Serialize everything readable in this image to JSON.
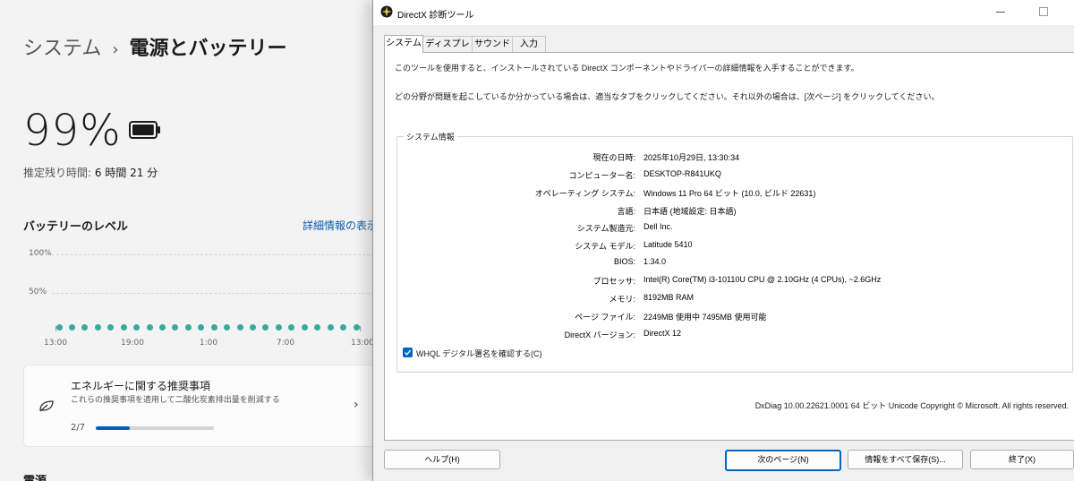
{
  "settings": {
    "breadcrumb_parent": "システム",
    "breadcrumb_sep": "›",
    "page_title": "電源とバッテリー",
    "battery_percent": "99%",
    "battery_level_fraction": 0.99,
    "remaining_label": "推定残り時間:",
    "remaining_value": "6 時間 21 分",
    "battery_level_heading": "バッテリーのレベル",
    "details_link": "詳細情報の表示",
    "chart_data": {
      "type": "scatter",
      "y_ticks": [
        "100%",
        "50%"
      ],
      "x_ticks": [
        "13:00",
        "19:00",
        "1:00",
        "7:00",
        "13:00"
      ],
      "ylim": [
        0,
        100
      ],
      "points_count": 24,
      "point_color": "#3aa99d"
    },
    "recommendation": {
      "title": "エネルギーに関する推奨事項",
      "subtitle": "これらの推奨事項を適用して二酸化炭素排出量を削減する",
      "progress_text": "2/7",
      "progress_fraction": 0.2857,
      "chevron": "›"
    },
    "power_heading": "電源"
  },
  "dxdiag": {
    "window_title": "DirectX 診断ツール",
    "tabs": [
      "システム",
      "ディスプレイ",
      "サウンド",
      "入力"
    ],
    "intro_line1": "このツールを使用すると、インストールされている DirectX コンポーネントやドライバーの詳細情報を入手することができます。",
    "intro_line2": "どの分野が問題を起こしているか分かっている場合は、適当なタブをクリックしてください。それ以外の場合は、[次ページ] をクリックしてください。",
    "group_title": "システム情報",
    "info": [
      {
        "key": "現在の日時:",
        "value": "2025年10月29日, 13:30:34"
      },
      {
        "key": "コンピューター名:",
        "value": "DESKTOP-R841UKQ"
      },
      {
        "key": "オペレーティング システム:",
        "value": "Windows 11 Pro 64 ビット (10.0, ビルド 22631)"
      },
      {
        "key": "言語:",
        "value": "日本語 (地域設定: 日本語)"
      },
      {
        "key": "システム製造元:",
        "value": "Dell Inc."
      },
      {
        "key": "システム モデル:",
        "value": "Latitude 5410"
      },
      {
        "key": "BIOS:",
        "value": "1.34.0"
      },
      {
        "key": "プロセッサ:",
        "value": "Intel(R) Core(TM) i3-10110U CPU @ 2.10GHz (4 CPUs), ~2.6GHz"
      },
      {
        "key": "メモリ:",
        "value": "8192MB RAM"
      },
      {
        "key": "ページ ファイル:",
        "value": "2249MB 使用中 7495MB 使用可能"
      },
      {
        "key": "DirectX バージョン:",
        "value": "DirectX 12"
      }
    ],
    "whql_label": "WHQL デジタル署名を確認する(C)",
    "whql_checked": true,
    "footer": "DxDiag 10.00.22621.0001 64 ビット Unicode  Copyright © Microsoft. All rights reserved.",
    "buttons": {
      "help": "ヘルプ(H)",
      "next": "次のページ(N)",
      "save": "情報をすべて保存(S)...",
      "exit": "終了(X)"
    }
  }
}
